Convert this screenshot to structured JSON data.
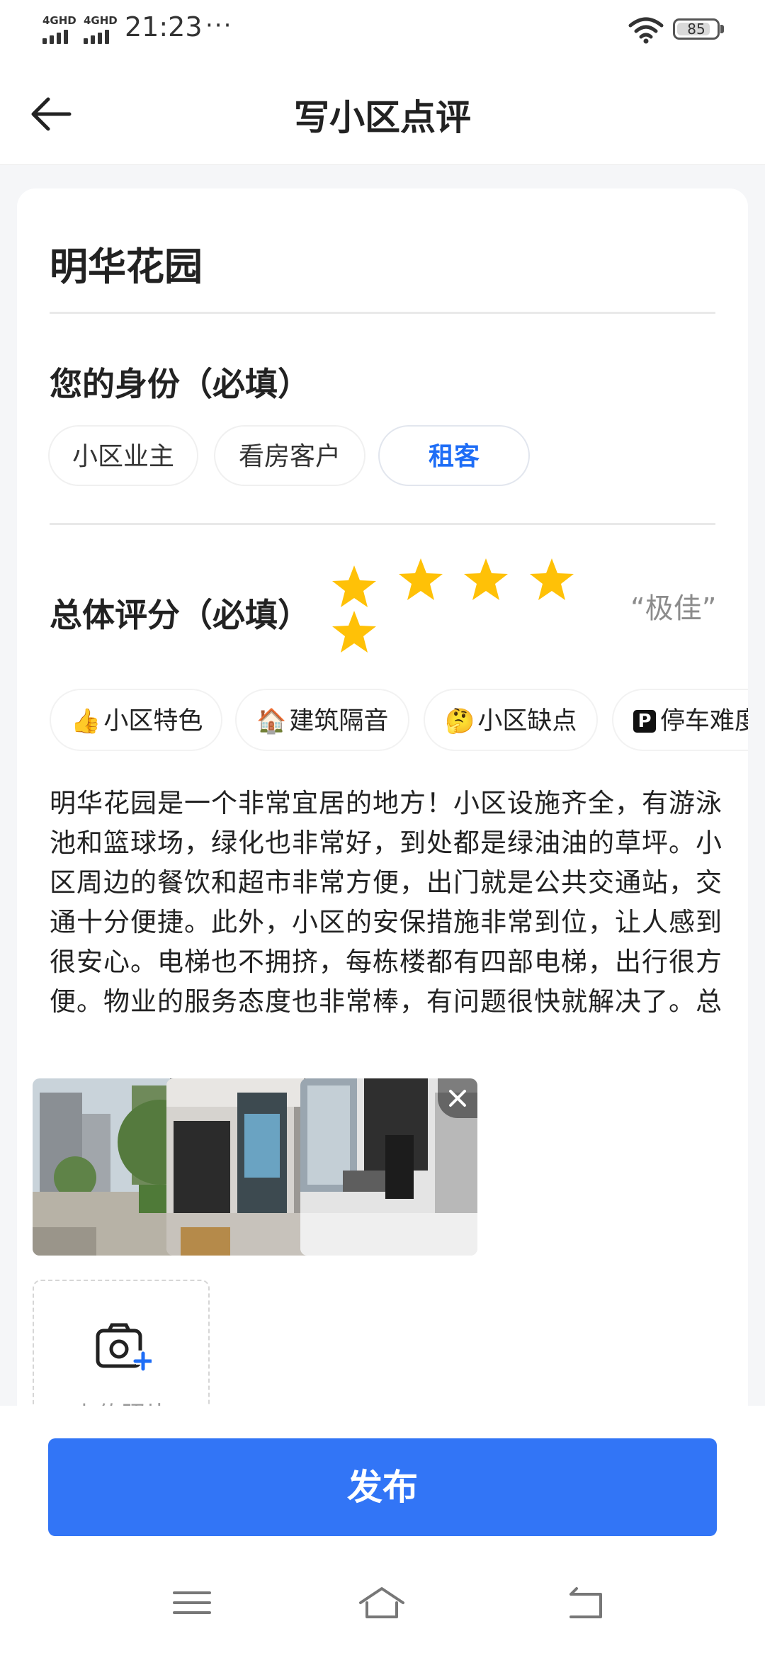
{
  "status_bar": {
    "network_1": "4GHD",
    "network_2": "4GHD",
    "time": "21:23",
    "more": "···",
    "battery": "85",
    "wifi_icon": "wifi-icon"
  },
  "header": {
    "title": "写小区点评",
    "back_icon": "arrow-left-icon"
  },
  "community": {
    "name": "明华花园"
  },
  "identity": {
    "title": "您的身份（必填）",
    "options": [
      "小区业主",
      "看房客户",
      "租客"
    ],
    "selected": "租客"
  },
  "rating": {
    "title": "总体评分（必填）",
    "stars": 5,
    "max_stars": 5,
    "label": "“极佳”",
    "star_color": "#ffc107"
  },
  "tags": [
    {
      "emoji": "👍",
      "label": "小区特色"
    },
    {
      "emoji": "🏠",
      "label": "建筑隔音"
    },
    {
      "emoji": "🤔",
      "label": "小区缺点"
    },
    {
      "emoji": "P",
      "label": "停车难度"
    }
  ],
  "review": {
    "text": "明华花园是一个非常宜居的地方！小区设施齐全，有游泳池和篮球场，绿化也非常好，到处都是绿油油的草坪。小区周边的餐饮和超市非常方便，出门就是公共交通站，交通十分便捷。此外，小区的安保措施非常到位，让人感到很安心。电梯也不拥挤，每栋楼都有四部电梯，出行很方便。物业的服务态度也非常棒，有问题很快就解决了。总之，无论是从地理位置"
  },
  "photos": {
    "close_icon": "close-icon",
    "upload_label": "上传照片",
    "upload_icon": "camera-plus-icon"
  },
  "publish": {
    "label": "发布",
    "color": "#3275f6"
  },
  "nav_bar": {
    "menu_icon": "menu-icon",
    "home_icon": "home-icon",
    "back_icon": "back-icon"
  }
}
